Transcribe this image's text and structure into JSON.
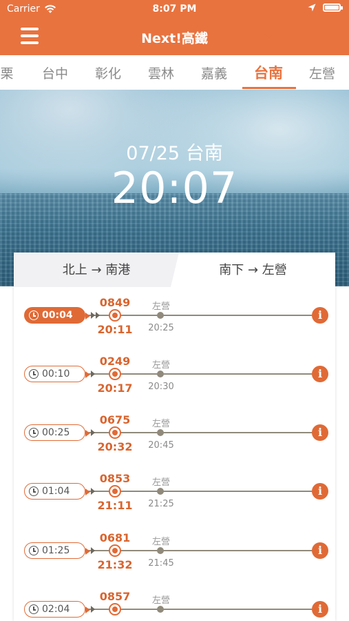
{
  "status_bar": {
    "carrier": "Carrier",
    "time": "8:07 PM"
  },
  "nav": {
    "title": "Next!高鐵"
  },
  "stations": [
    "栗",
    "台中",
    "彰化",
    "雲林",
    "嘉義",
    "台南",
    "左營"
  ],
  "selected_station": "台南",
  "hero": {
    "date": "07/25 台南",
    "time": "20:07"
  },
  "direction_tabs": {
    "north": "北上 → 南港",
    "south": "南下 → 左營",
    "selected": "south"
  },
  "trains": [
    {
      "countdown": "00:04",
      "train_no": "0849",
      "dep_time": "20:11",
      "dest": "左營",
      "arr_time": "20:25",
      "active": true
    },
    {
      "countdown": "00:10",
      "train_no": "0249",
      "dep_time": "20:17",
      "dest": "左營",
      "arr_time": "20:30",
      "active": false
    },
    {
      "countdown": "00:25",
      "train_no": "0675",
      "dep_time": "20:32",
      "dest": "左營",
      "arr_time": "20:45",
      "active": false
    },
    {
      "countdown": "01:04",
      "train_no": "0853",
      "dep_time": "21:11",
      "dest": "左營",
      "arr_time": "21:25",
      "active": false
    },
    {
      "countdown": "01:25",
      "train_no": "0681",
      "dep_time": "21:32",
      "dest": "左營",
      "arr_time": "21:45",
      "active": false
    },
    {
      "countdown": "02:04",
      "train_no": "0857",
      "dep_time": "",
      "dest": "左營",
      "arr_time": "",
      "active": false
    }
  ],
  "colors": {
    "accent": "#e8733f",
    "track": "#908a7c"
  },
  "icons": {
    "menu": "hamburger-icon",
    "info": "info-icon",
    "clock": "clock-icon",
    "wifi": "wifi-icon",
    "location": "location-arrow-icon",
    "battery": "battery-icon"
  }
}
